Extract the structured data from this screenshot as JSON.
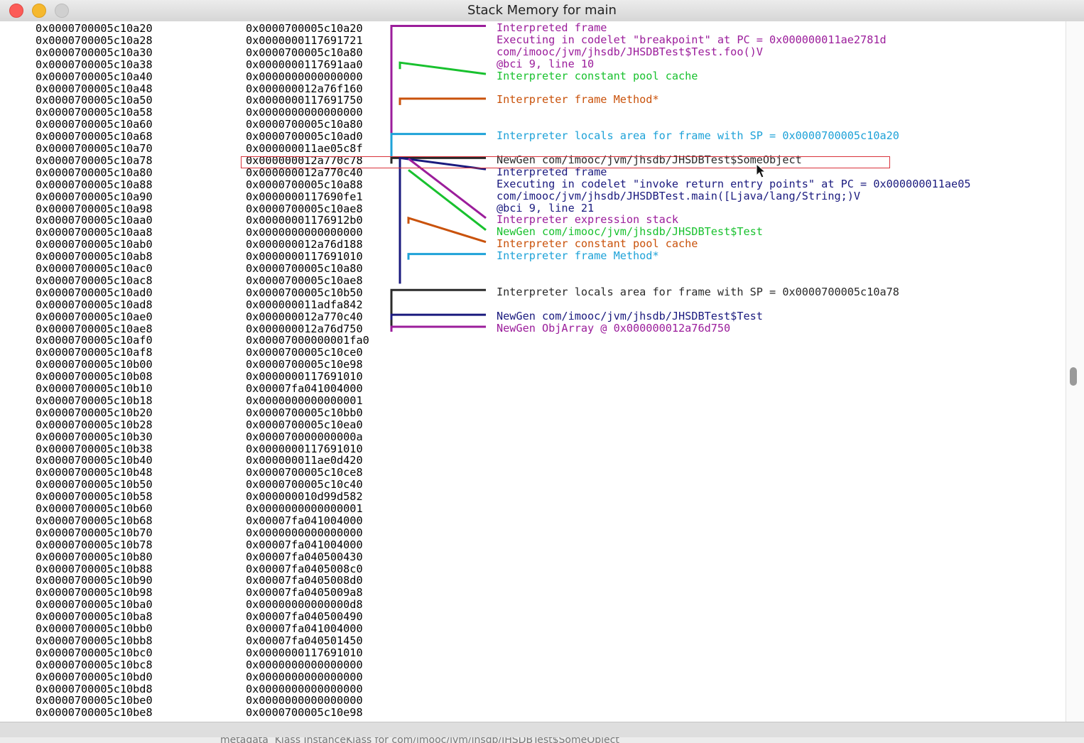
{
  "window": {
    "title": "Stack Memory for main"
  },
  "colors": {
    "purple": "#9b1d9b",
    "green": "#18c12e",
    "orange": "#c9520b",
    "cyan": "#1ea2d8",
    "navy": "#1a1a7e",
    "dark": "#2a2a2a",
    "highlight_border": "#d9323b"
  },
  "stack": {
    "rows": [
      {
        "addr": "0x0000700005c10a20",
        "value": "0x0000700005c10a20"
      },
      {
        "addr": "0x0000700005c10a28",
        "value": "0x0000000117691721"
      },
      {
        "addr": "0x0000700005c10a30",
        "value": "0x0000700005c10a80"
      },
      {
        "addr": "0x0000700005c10a38",
        "value": "0x00000001176 91aa0"
      },
      {
        "addr": "0x0000700005c10a40",
        "value": "0x0000000000000000"
      },
      {
        "addr": "0x0000700005c10a48",
        "value": "0x000000012a76f160"
      },
      {
        "addr": "0x0000700005c10a50",
        "value": "0x0000000117691750"
      },
      {
        "addr": "0x0000700005c10a58",
        "value": "0x0000000000000000"
      },
      {
        "addr": "0x0000700005c10a60",
        "value": "0x0000700005c10a80"
      },
      {
        "addr": "0x0000700005c10a68",
        "value": "0x0000700005c10ad0"
      },
      {
        "addr": "0x0000700005c10a70",
        "value": "0x000000011ae05c8f"
      },
      {
        "addr": "0x0000700005c10a78",
        "value": "0x000000012a770c78"
      },
      {
        "addr": "0x0000700005c10a80",
        "value": "0x000000012a770c40"
      },
      {
        "addr": "0x0000700005c10a88",
        "value": "0x0000700005c10a88"
      },
      {
        "addr": "0x0000700005c10a90",
        "value": "0x0000000117690fe1"
      },
      {
        "addr": "0x0000700005c10a98",
        "value": "0x0000700005c10ae8"
      },
      {
        "addr": "0x0000700005c10aa0",
        "value": "0x00000001176912b0"
      },
      {
        "addr": "0x0000700005c10aa8",
        "value": "0x0000000000000000"
      },
      {
        "addr": "0x0000700005c10ab0",
        "value": "0x000000012a76d188"
      },
      {
        "addr": "0x0000700005c10ab8",
        "value": "0x0000000117691010"
      },
      {
        "addr": "0x0000700005c10ac0",
        "value": "0x0000700005c10a80"
      },
      {
        "addr": "0x0000700005c10ac8",
        "value": "0x0000700005c10ae8"
      },
      {
        "addr": "0x0000700005c10ad0",
        "value": "0x0000700005c10b50"
      },
      {
        "addr": "0x0000700005c10ad8",
        "value": "0x000000011adfa842"
      },
      {
        "addr": "0x0000700005c10ae0",
        "value": "0x000000012a770c40"
      },
      {
        "addr": "0x0000700005c10ae8",
        "value": "0x000000012a76d750"
      },
      {
        "addr": "0x0000700005c10af0",
        "value": "0x00007000000001fa0"
      },
      {
        "addr": "0x0000700005c10af8",
        "value": "0x0000700005c10ce0"
      },
      {
        "addr": "0x0000700005c10b00",
        "value": "0x0000700005c10e98"
      },
      {
        "addr": "0x0000700005c10b08",
        "value": "0x0000000117691010"
      },
      {
        "addr": "0x0000700005c10b10",
        "value": "0x00007fa041004000"
      },
      {
        "addr": "0x0000700005c10b18",
        "value": "0x0000000000000001"
      },
      {
        "addr": "0x0000700005c10b20",
        "value": "0x0000700005c10bb0"
      },
      {
        "addr": "0x0000700005c10b28",
        "value": "0x0000700005c10ea0"
      },
      {
        "addr": "0x0000700005c10b30",
        "value": "0x000070000000000a"
      },
      {
        "addr": "0x0000700005c10b38",
        "value": "0x0000000117691010"
      },
      {
        "addr": "0x0000700005c10b40",
        "value": "0x000000011ae0d420"
      },
      {
        "addr": "0x0000700005c10b48",
        "value": "0x0000700005c10ce8"
      },
      {
        "addr": "0x0000700005c10b50",
        "value": "0x0000700005c10c40"
      },
      {
        "addr": "0x0000700005c10b58",
        "value": "0x000000010d99d582"
      },
      {
        "addr": "0x0000700005c10b60",
        "value": "0x0000000000000001"
      },
      {
        "addr": "0x0000700005c10b68",
        "value": "0x00007fa041004000"
      },
      {
        "addr": "0x0000700005c10b70",
        "value": "0x0000000000000000"
      },
      {
        "addr": "0x0000700005c10b78",
        "value": "0x00007fa041004000"
      },
      {
        "addr": "0x0000700005c10b80",
        "value": "0x00007fa040500430"
      },
      {
        "addr": "0x0000700005c10b88",
        "value": "0x00007fa0405008c0"
      },
      {
        "addr": "0x0000700005c10b90",
        "value": "0x00007fa0405008d0"
      },
      {
        "addr": "0x0000700005c10b98",
        "value": "0x00007fa0405009a8"
      },
      {
        "addr": "0x0000700005c10ba0",
        "value": "0x00000000000000d8"
      },
      {
        "addr": "0x0000700005c10ba8",
        "value": "0x00007fa040500490"
      },
      {
        "addr": "0x0000700005c10bb0",
        "value": "0x00007fa041004000"
      },
      {
        "addr": "0x0000700005c10bb8",
        "value": "0x00007fa040501450"
      },
      {
        "addr": "0x0000700005c10bc0",
        "value": "0x0000000117691010"
      },
      {
        "addr": "0x0000700005c10bc8",
        "value": "0x0000000000000000"
      },
      {
        "addr": "0x0000700005c10bd0",
        "value": "0x0000000000000000"
      },
      {
        "addr": "0x0000700005c10bd8",
        "value": "0x0000000000000000"
      },
      {
        "addr": "0x0000700005c10be0",
        "value": "0x0000000000000000"
      },
      {
        "addr": "0x0000700005c10be8",
        "value": "0x0000700005c10e98"
      }
    ]
  },
  "annotations": [
    {
      "text": "Interpreted frame",
      "color": "purple"
    },
    {
      "text": "Executing in codelet \"breakpoint\" at PC = 0x000000011ae2781d",
      "color": "purple"
    },
    {
      "text": "com/imooc/jvm/jhsdb/JHSDBTest$Test.foo()V",
      "color": "purple"
    },
    {
      "text": "@bci 9, line 10",
      "color": "purple"
    },
    {
      "text": "Interpreter constant pool cache",
      "color": "green"
    },
    {
      "text": "Interpreter frame Method*",
      "color": "orange"
    },
    {
      "text": "Interpreter locals area for frame with SP = 0x0000700005c10a20",
      "color": "cyan"
    },
    {
      "text": "NewGen com/imooc/jvm/jhsdb/JHSDBTest$SomeObject",
      "color": "dark"
    },
    {
      "text": "Interpreted frame",
      "color": "navy"
    },
    {
      "text": "Executing in codelet \"invoke return entry points\" at PC = 0x000000011ae05",
      "color": "navy"
    },
    {
      "text": "com/imooc/jvm/jhsdb/JHSDBTest.main([Ljava/lang/String;)V",
      "color": "navy"
    },
    {
      "text": "@bci 9, line 21",
      "color": "navy"
    },
    {
      "text": "Interpreter expression stack",
      "color": "purple"
    },
    {
      "text": "NewGen com/imooc/jvm/jhsdb/JHSDBTest$Test",
      "color": "green"
    },
    {
      "text": "Interpreter constant pool cache",
      "color": "orange"
    },
    {
      "text": "Interpreter frame Method*",
      "color": "cyan"
    },
    {
      "text": "Interpreter locals area for frame with SP = 0x0000700005c10a78",
      "color": "dark"
    },
    {
      "text": "NewGen com/imooc/jvm/jhsdb/JHSDBTest$Test",
      "color": "navy"
    },
    {
      "text": "NewGen ObjArray @ 0x000000012a76d750",
      "color": "purple"
    }
  ],
  "below_window": {
    "text": "metadata  Klass InstanceKlass for com/imooc/jvm/jhsdb/JHSDBTest$SomeObject"
  }
}
